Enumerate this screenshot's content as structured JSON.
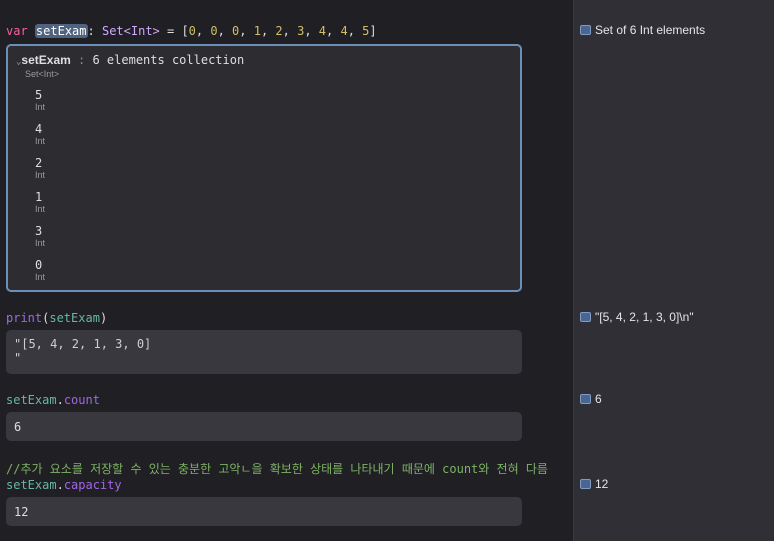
{
  "code": {
    "line1": {
      "kw": "var",
      "name": "setExam",
      "colon": ":",
      "type": "Set<Int>",
      "eq": " = [",
      "values": [
        "0",
        "0",
        "0",
        "1",
        "2",
        "3",
        "4",
        "4",
        "5"
      ],
      "close": "]"
    },
    "inspector": {
      "name": "setExam",
      "summary": "6 elements collection",
      "type": "Set<Int>",
      "elements": [
        {
          "value": "5",
          "type": "Int"
        },
        {
          "value": "4",
          "type": "Int"
        },
        {
          "value": "2",
          "type": "Int"
        },
        {
          "value": "1",
          "type": "Int"
        },
        {
          "value": "3",
          "type": "Int"
        },
        {
          "value": "0",
          "type": "Int"
        }
      ]
    },
    "line2": {
      "func": "print",
      "open": "(",
      "arg": "setExam",
      "close": ")",
      "result_line1": "\"[5, 4, 2, 1, 3, 0]",
      "result_line2": "\""
    },
    "line3": {
      "obj": "setExam",
      "dot": ".",
      "prop": "count",
      "result": "6"
    },
    "comment": "//추가 요소를 저장할 수 있는 충분한 고악ㄴ을 확보한 상태를 나타내기 때문에 count와 전혀 다름",
    "line4": {
      "obj": "setExam",
      "dot": ".",
      "prop": "capacity",
      "result": "12"
    }
  },
  "sidebar": {
    "results": [
      "Set of 6 Int elements",
      "\"[5, 4, 2, 1, 3, 0]\\n\"",
      "6",
      "12"
    ]
  }
}
